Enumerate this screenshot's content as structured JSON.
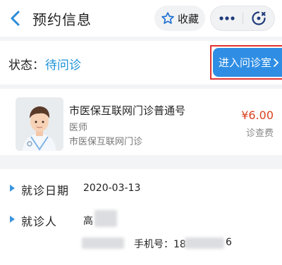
{
  "header": {
    "title": "预约信息",
    "favorite_label": "收藏"
  },
  "status": {
    "label": "状态：",
    "value": "待问诊",
    "enter_button": "进入问诊室"
  },
  "doctor": {
    "dept_name": "市医保互联网门诊普通号",
    "role": "医师",
    "dept_sub": "市医保互联网门诊",
    "price": "¥6.00",
    "fee_label": "诊查费"
  },
  "visit": {
    "date_label": "就诊日期",
    "date_value": "2020-03-13",
    "patient_label": "就诊人",
    "patient_name": "高",
    "phone_label": "手机号：18",
    "phone_tail": "6"
  },
  "colors": {
    "accent": "#2f8ee4",
    "status_blue": "#1a91d8",
    "price_red": "#d8421e",
    "highlight_border": "#e23232"
  }
}
